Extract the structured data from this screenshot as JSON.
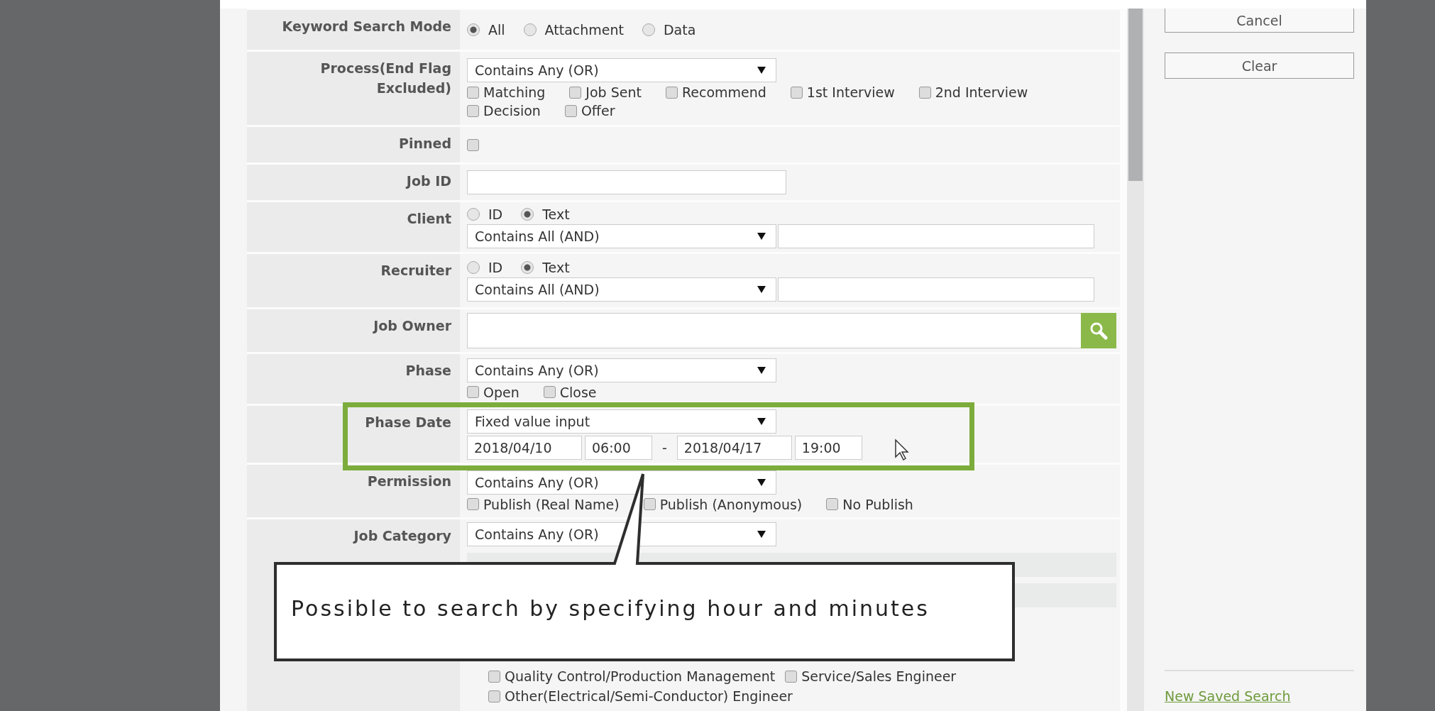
{
  "fields": [
    {
      "label": "Keyword Search Mode",
      "kind": "radios",
      "options": [
        {
          "label": "All",
          "selected": true
        },
        {
          "label": "Attachment",
          "selected": false
        },
        {
          "label": "Data",
          "selected": false
        }
      ]
    },
    {
      "label": "Process(End Flag Excluded)",
      "kind": "select-checks",
      "select": "Contains Any (OR)",
      "checks": [
        {
          "label": "Matching",
          "checked": false
        },
        {
          "label": "Job Sent",
          "checked": false
        },
        {
          "label": "Recommend",
          "checked": false
        },
        {
          "label": "1st Interview",
          "checked": false
        },
        {
          "label": "2nd Interview",
          "checked": false
        },
        {
          "label": "Decision",
          "checked": false
        },
        {
          "label": "Offer",
          "checked": false
        }
      ]
    },
    {
      "label": "Pinned",
      "kind": "check",
      "checked": false
    },
    {
      "label": "Job ID",
      "kind": "text"
    },
    {
      "label": "Client",
      "kind": "radio-select-text",
      "options": [
        {
          "label": "ID",
          "selected": false
        },
        {
          "label": "Text",
          "selected": true
        }
      ],
      "select": "Contains All (AND)"
    },
    {
      "label": "Recruiter",
      "kind": "radio-select-text",
      "options": [
        {
          "label": "ID",
          "selected": false
        },
        {
          "label": "Text",
          "selected": true
        }
      ],
      "select": "Contains All (AND)"
    },
    {
      "label": "Job Owner",
      "kind": "lookup"
    },
    {
      "label": "Phase",
      "kind": "select-checks",
      "select": "Contains Any (OR)",
      "checks": [
        {
          "label": "Open",
          "checked": false
        },
        {
          "label": "Close",
          "checked": false
        }
      ]
    },
    {
      "label": "Phase Date",
      "kind": "date-range",
      "select": "Fixed value input",
      "from_date": "2018/04/10",
      "from_time": "06:00",
      "separator": "-",
      "to_date": "2018/04/17",
      "to_time": "19:00"
    },
    {
      "label": "Permission",
      "kind": "select-checks",
      "select": "Contains Any (OR)",
      "checks": [
        {
          "label": "Publish (Real Name)",
          "checked": false
        },
        {
          "label": "Publish (Anonymous)",
          "checked": false
        },
        {
          "label": "No Publish",
          "checked": false
        }
      ]
    },
    {
      "label": "Job Category",
      "kind": "category",
      "select": "Contains Any (OR)",
      "items": [
        {
          "label": "Quality Control/Production Management",
          "checked": false
        },
        {
          "label": "Service/Sales Engineer",
          "checked": false
        },
        {
          "label": "Other(Electrical/Semi-Conductor) Engineer",
          "checked": false
        }
      ]
    }
  ],
  "buttons": [
    "Cancel",
    "Clear"
  ],
  "link": "New Saved Search",
  "callout": "Possible to search by specifying hour and minutes"
}
